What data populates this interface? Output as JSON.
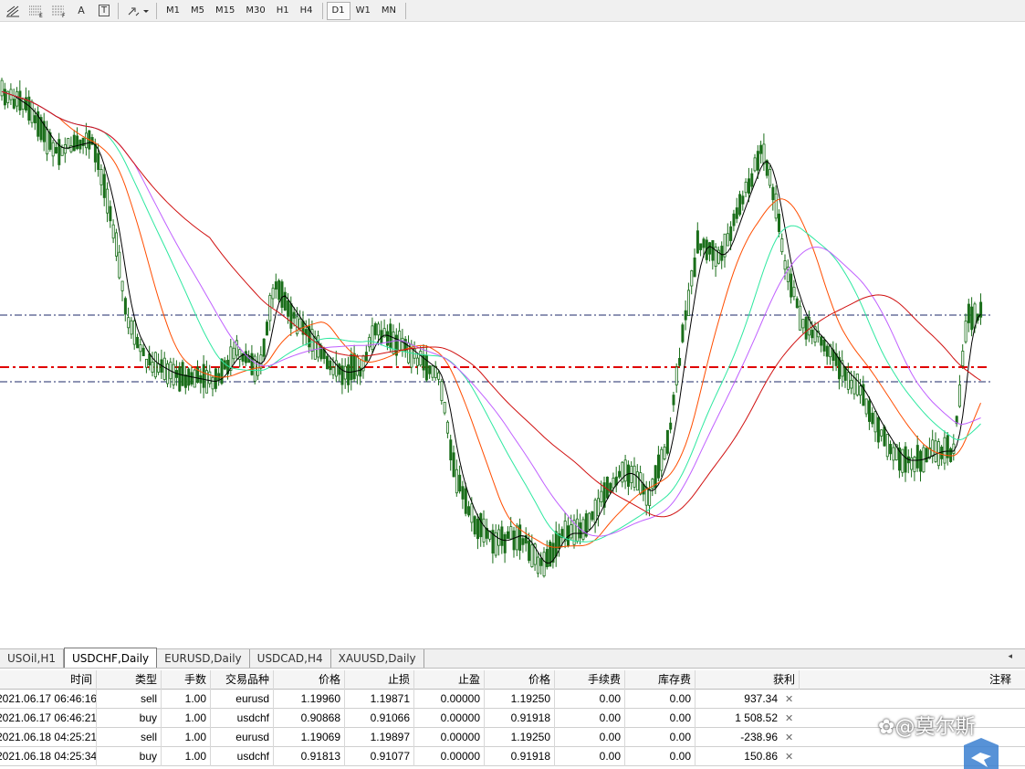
{
  "toolbar": {
    "icons": [
      "grid-lines-tool",
      "fibonacci-tool",
      "fibonacci-fan-tool",
      "text-tool",
      "text-label-tool",
      "arrows-dropdown"
    ],
    "text_tool_label": "A",
    "label_tool_label": "T",
    "timeframes": [
      "M1",
      "M5",
      "M15",
      "M30",
      "H1",
      "H4",
      "D1",
      "W1",
      "MN"
    ],
    "active_timeframe": "D1"
  },
  "chart": {
    "symbol": "USDCHF",
    "timeframe": "Daily",
    "colors": {
      "candle_up": "#1a6e1a",
      "ma_black": "#000000",
      "ma_orange": "#ff4d00",
      "ma_teal": "#2ee8a0",
      "ma_violet": "#c060ff",
      "ma_red": "#d01010",
      "line_dark": "#1c2a6a",
      "line_red": "#e00000"
    }
  },
  "tabs": [
    {
      "label": "USOil,H1",
      "active": false
    },
    {
      "label": "USDCHF,Daily",
      "active": true
    },
    {
      "label": "EURUSD,Daily",
      "active": false
    },
    {
      "label": "USDCAD,H4",
      "active": false
    },
    {
      "label": "XAUUSD,Daily",
      "active": false
    }
  ],
  "trades": {
    "columns": [
      "时间",
      "类型",
      "手数",
      "交易品种",
      "价格",
      "止损",
      "止盈",
      "价格",
      "手续费",
      "库存费",
      "获利",
      "注释"
    ],
    "rows": [
      {
        "time": "2021.06.17 06:46:16",
        "type": "sell",
        "lots": "1.00",
        "symbol": "eurusd",
        "price": "1.19960",
        "sl": "1.19871",
        "tp": "0.00000",
        "cur_price": "1.19250",
        "commission": "0.00",
        "swap": "0.00",
        "profit": "937.34"
      },
      {
        "time": "2021.06.17 06:46:21",
        "type": "buy",
        "lots": "1.00",
        "symbol": "usdchf",
        "price": "0.90868",
        "sl": "0.91066",
        "tp": "0.00000",
        "cur_price": "0.91918",
        "commission": "0.00",
        "swap": "0.00",
        "profit": "1 508.52"
      },
      {
        "time": "2021.06.18 04:25:21",
        "type": "sell",
        "lots": "1.00",
        "symbol": "eurusd",
        "price": "1.19069",
        "sl": "1.19897",
        "tp": "0.00000",
        "cur_price": "1.19250",
        "commission": "0.00",
        "swap": "0.00",
        "profit": "-238.96"
      },
      {
        "time": "2021.06.18 04:25:34",
        "type": "buy",
        "lots": "1.00",
        "symbol": "usdchf",
        "price": "0.91813",
        "sl": "0.91077",
        "tp": "0.00000",
        "cur_price": "0.91918",
        "commission": "0.00",
        "swap": "0.00",
        "profit": "150.86"
      }
    ]
  },
  "watermark": {
    "text": "@莫尔斯"
  }
}
